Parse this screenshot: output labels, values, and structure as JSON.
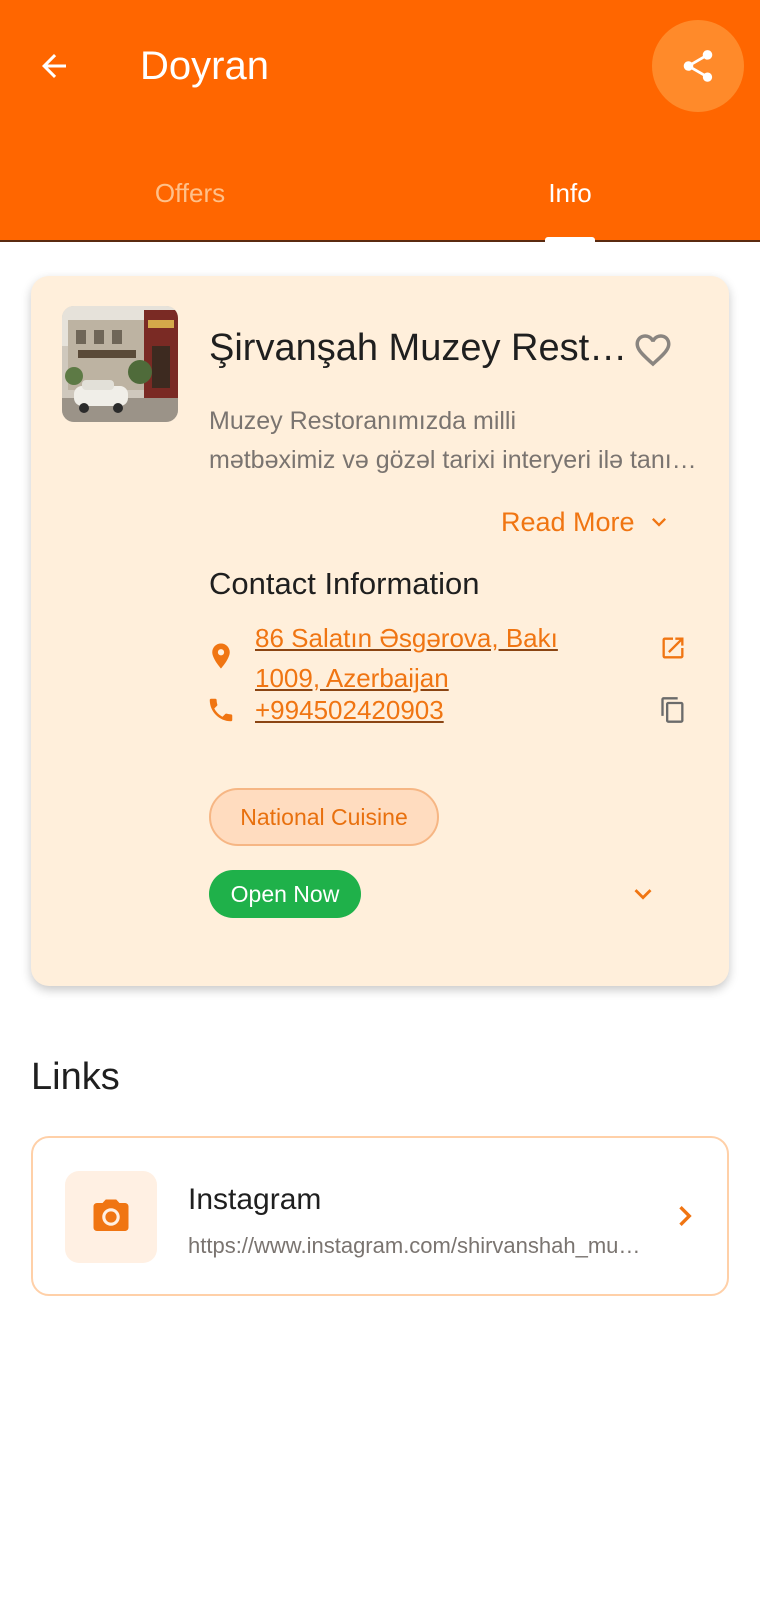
{
  "header": {
    "title": "Doyran",
    "back_icon": "arrow-left-icon",
    "share_icon": "share-icon"
  },
  "tabs": [
    {
      "label": "Offers",
      "selected": false
    },
    {
      "label": "Info",
      "selected": true
    }
  ],
  "colors": {
    "brand": "#ff6600",
    "accent": "#f07512",
    "card_bg": "#ffefdb",
    "open": "#1fb14a"
  },
  "venue": {
    "name": "Şirvanşah Muzey Restoranı",
    "description_lines": [
      "Muzey Restoranımızda milli",
      "mətbəximiz və gözəl tarixi interyeri ilə tanış olun"
    ],
    "read_more": "Read More",
    "favorite_icon": "heart-outline-icon"
  },
  "contact": {
    "title": "Contact Information",
    "address_line1": "86 Salatın Əsgərova, Bakı",
    "address_line2": "1009, Azerbaijan",
    "phone": "+994502420903",
    "address_icon": "location-pin-icon",
    "phone_icon": "phone-icon",
    "open_external_icon": "open-external-icon",
    "copy_icon": "copy-icon"
  },
  "category": "National Cuisine",
  "status": "Open Now",
  "links": {
    "title": "Links",
    "items": [
      {
        "title": "Instagram",
        "url": "https://www.instagram.com/shirvanshah_museum",
        "icon": "camera-icon"
      }
    ]
  }
}
